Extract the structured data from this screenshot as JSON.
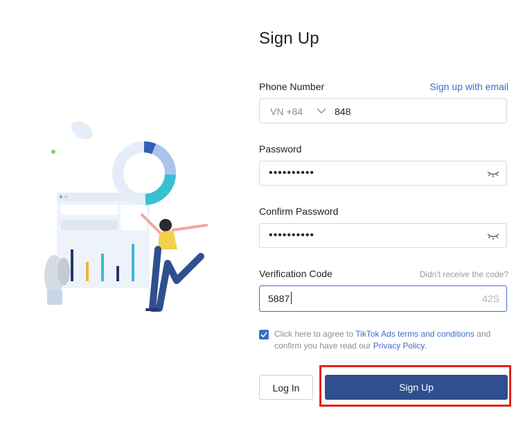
{
  "form": {
    "title": "Sign Up",
    "phone": {
      "label": "Phone Number",
      "alt_link": "Sign up with email",
      "country_code": "VN +84",
      "value": "848"
    },
    "password": {
      "label": "Password",
      "masked_value": "••••••••••"
    },
    "confirm_password": {
      "label": "Confirm Password",
      "masked_value": "••••••••••"
    },
    "verification": {
      "label": "Verification Code",
      "resend_hint": "Didn't receive the code?",
      "value": "5887",
      "timer": "42S"
    },
    "agreement": {
      "checked": true,
      "text_1": "Click here to agree to ",
      "terms_link": "TikTok Ads terms and conditions",
      "text_2": " and confirm you have read our ",
      "privacy_link": "Privacy Policy",
      "text_3": "."
    },
    "buttons": {
      "login": "Log In",
      "signup": "Sign Up"
    }
  },
  "colors": {
    "accent": "#3a6cc9",
    "primary_button": "#2f4f8e",
    "highlight": "#e1251b"
  }
}
